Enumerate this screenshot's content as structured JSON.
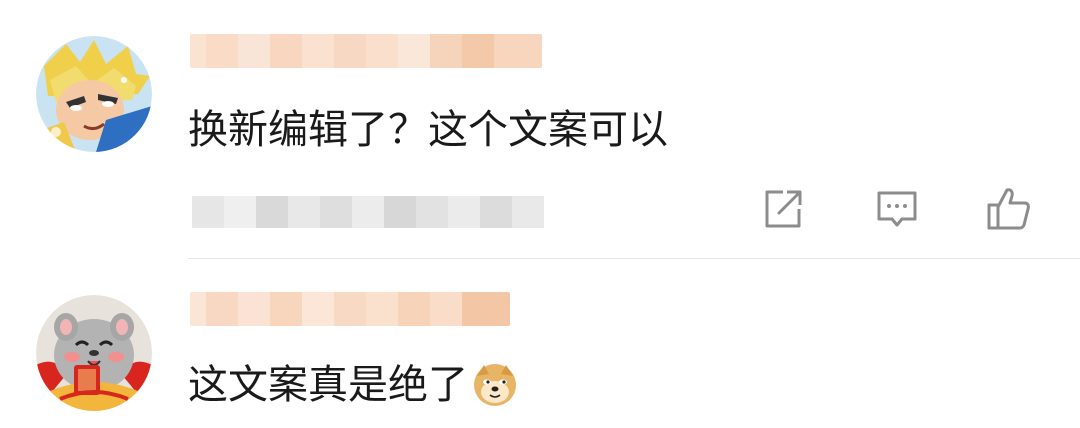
{
  "comments": [
    {
      "text": "换新编辑了？这个文案可以",
      "actions": {
        "share_icon": "share-icon",
        "reply_icon": "comment-icon",
        "like_icon": "thumbs-up-icon"
      }
    },
    {
      "text": "这文案真是绝了",
      "emoji": "doge-emoji"
    }
  ],
  "colors": {
    "text": "#1a1a1a",
    "icon": "#8c8c8c",
    "divider": "#e6e6e6",
    "name_blur": "#f6d6bf",
    "meta_blur": "#e4e4e4"
  }
}
